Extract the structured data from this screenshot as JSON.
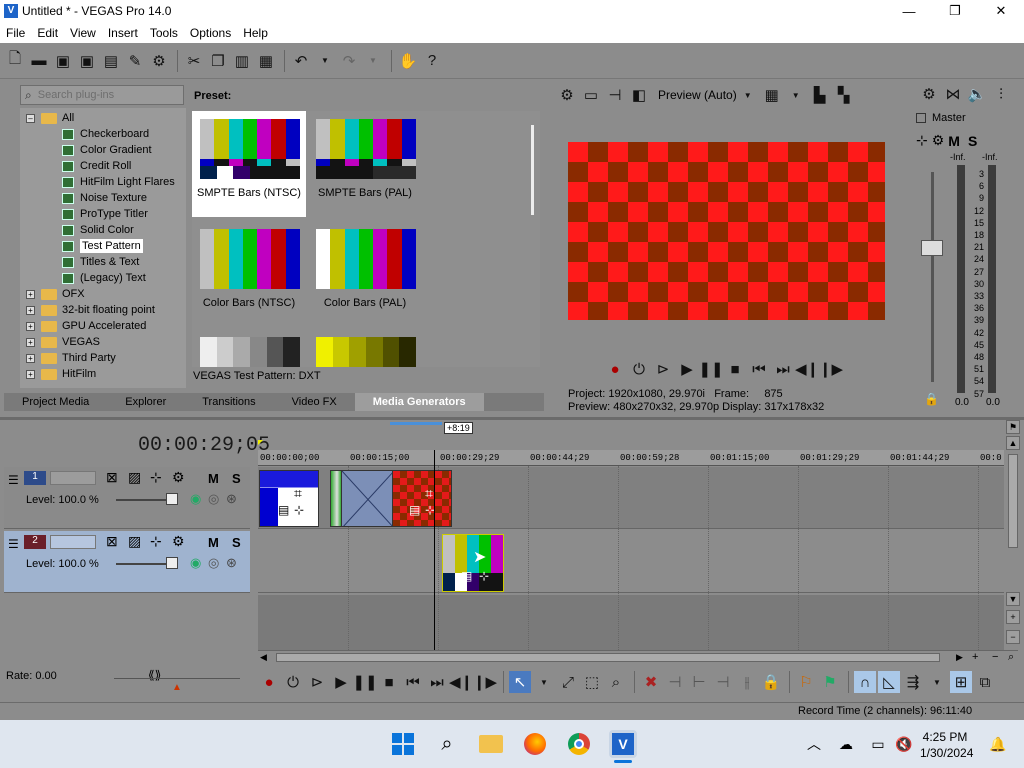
{
  "window": {
    "title": "Untitled * - VEGAS Pro 14.0",
    "minimize_glyph": "—",
    "maximize_glyph": "❐",
    "close_glyph": "✕"
  },
  "menu": [
    "File",
    "Edit",
    "View",
    "Insert",
    "Tools",
    "Options",
    "Help"
  ],
  "plugins": {
    "search_placeholder": "Search plug-ins",
    "tree": [
      {
        "label": "All",
        "kind": "folder",
        "expanded": true
      },
      {
        "label": "Checkerboard",
        "kind": "plugin"
      },
      {
        "label": "Color Gradient",
        "kind": "plugin"
      },
      {
        "label": "Credit Roll",
        "kind": "plugin"
      },
      {
        "label": "HitFilm Light Flares",
        "kind": "plugin"
      },
      {
        "label": "Noise Texture",
        "kind": "plugin"
      },
      {
        "label": "ProType Titler",
        "kind": "plugin"
      },
      {
        "label": "Solid Color",
        "kind": "plugin"
      },
      {
        "label": "Test Pattern",
        "kind": "plugin",
        "selected": true
      },
      {
        "label": "Titles & Text",
        "kind": "plugin"
      },
      {
        "label": "(Legacy) Text",
        "kind": "plugin"
      },
      {
        "label": "OFX",
        "kind": "folder"
      },
      {
        "label": "32-bit floating point",
        "kind": "folder"
      },
      {
        "label": "GPU Accelerated",
        "kind": "folder"
      },
      {
        "label": "VEGAS",
        "kind": "folder"
      },
      {
        "label": "Third Party",
        "kind": "folder"
      },
      {
        "label": "HitFilm",
        "kind": "folder"
      }
    ],
    "preset_label": "Preset:",
    "presets": [
      {
        "label": "SMPTE Bars (NTSC)",
        "selected": true
      },
      {
        "label": "SMPTE Bars (PAL)"
      },
      {
        "label": "Color Bars (NTSC)"
      },
      {
        "label": "Color Bars (PAL)"
      }
    ],
    "fx_info": "VEGAS Test Pattern: DXT"
  },
  "tabs": [
    "Project Media",
    "Explorer",
    "Transitions",
    "Video FX",
    "Media Generators"
  ],
  "active_tab": "Media Generators",
  "preview": {
    "mode": "Preview (Auto)",
    "project_label": "Project:",
    "project_value": "1920x1080, 29.970i",
    "preview_label": "Preview:",
    "preview_value": "480x270x32, 29.970p",
    "frame_label": "Frame:",
    "frame_value": "875",
    "display_label": "Display:",
    "display_value": "317x178x32"
  },
  "master": {
    "label": "Master",
    "peak_left": "-Inf.",
    "peak_right": "-Inf.",
    "scale": [
      "3",
      "6",
      "9",
      "12",
      "15",
      "18",
      "21",
      "24",
      "27",
      "30",
      "33",
      "36",
      "39",
      "42",
      "45",
      "48",
      "51",
      "54",
      "57"
    ],
    "level_left": "0.0",
    "level_right": "0.0",
    "mute": "M",
    "solo": "S"
  },
  "timeline": {
    "timecode": "00:00:29;05",
    "loop_marker": "+8:19",
    "ruler": [
      "00:00:00;00",
      "00:00:15;00",
      "00:00:29;29",
      "00:00:44;29",
      "00:00:59;28",
      "00:01:15;00",
      "00:01:29;29",
      "00:01:44;29",
      "00:0"
    ],
    "tracks": [
      {
        "number": "1",
        "level": "Level: 100.0 %",
        "mute": "M",
        "solo": "S"
      },
      {
        "number": "2",
        "level": "Level: 100.0 %",
        "mute": "M",
        "solo": "S"
      }
    ],
    "rate": "Rate: 0.00"
  },
  "status": {
    "record_time": "Record Time (2 channels): 96:11:40"
  },
  "taskbar": {
    "time": "4:25 PM",
    "date": "1/30/2024"
  }
}
